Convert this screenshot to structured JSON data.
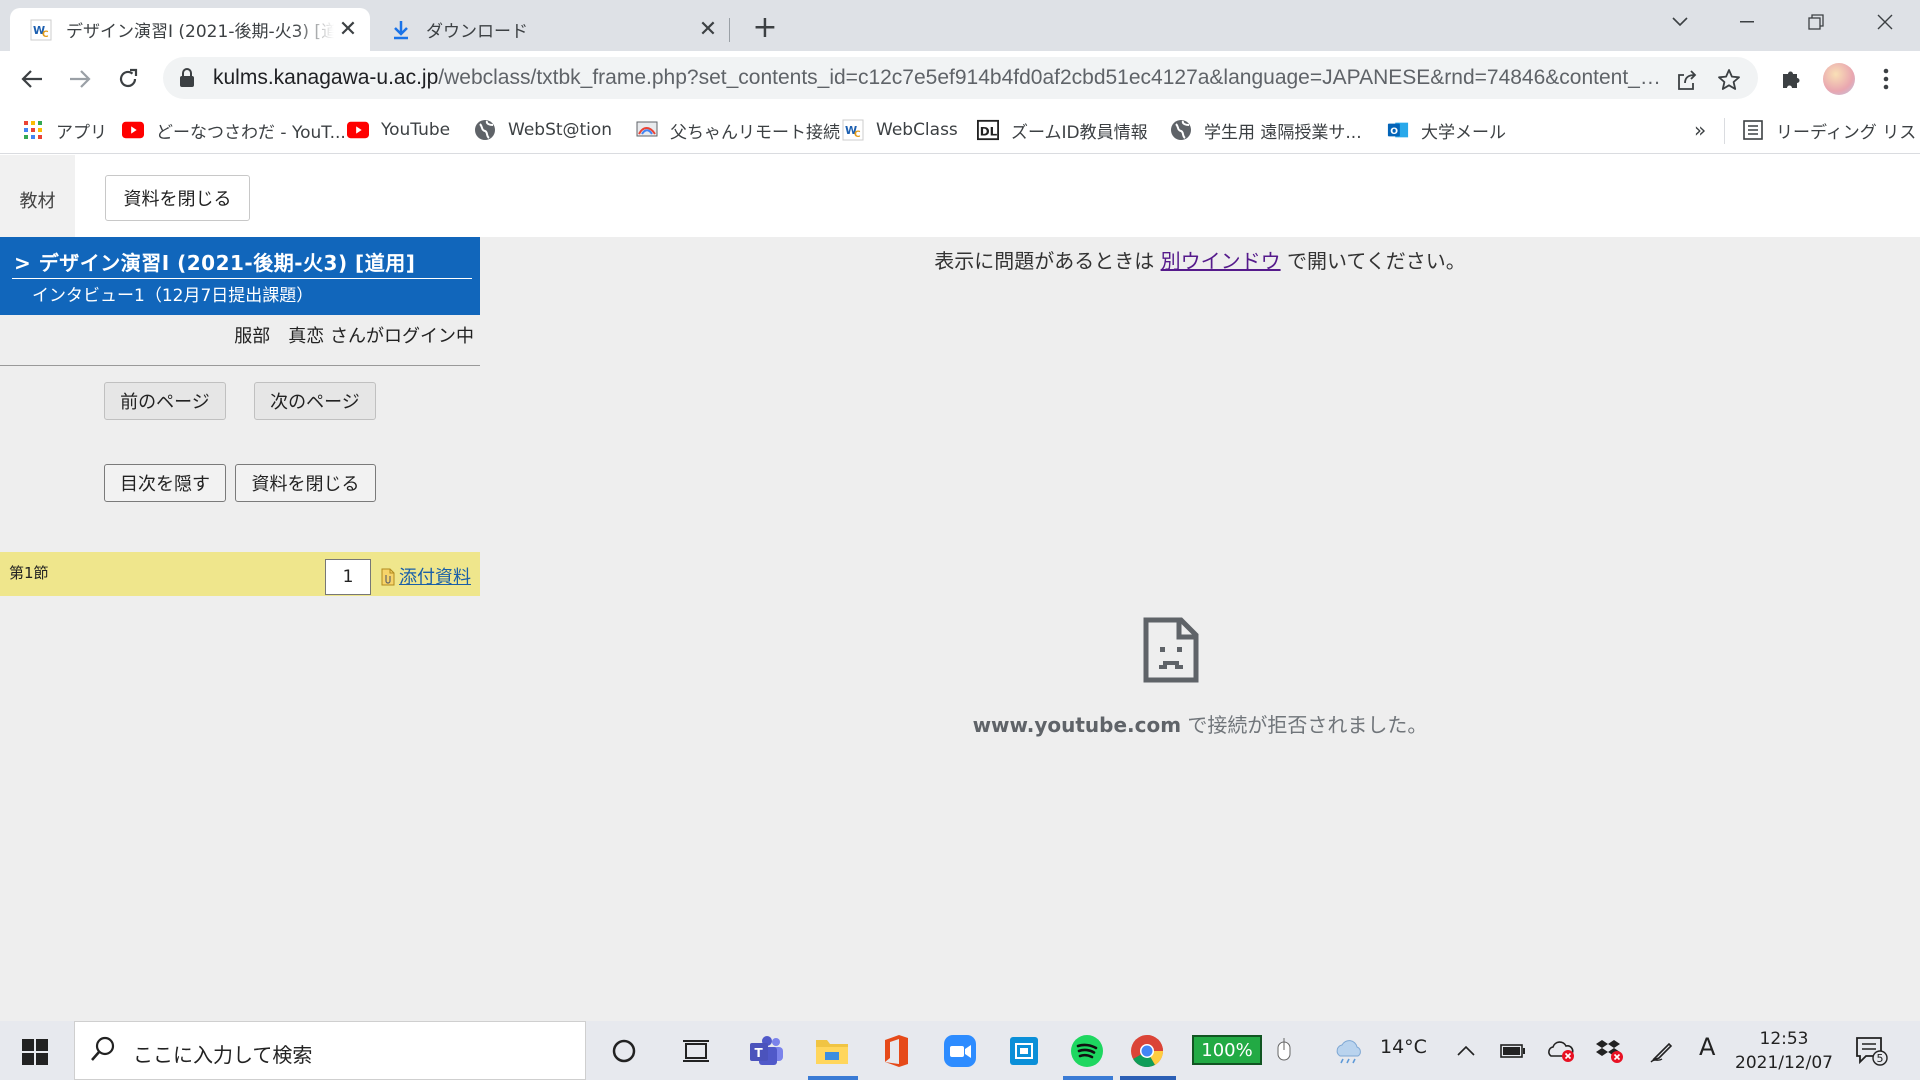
{
  "browser": {
    "tabs": [
      {
        "title": "デザイン演習I (2021-後期-火3) [道用]",
        "active": true
      },
      {
        "title": "ダウンロード",
        "active": false
      }
    ],
    "url_host": "kulms.kanagawa-u.ac.jp",
    "url_path": "/webclass/txtbk_frame.php?set_contents_id=c12c7e5ef914b4fd0af2cbd51ec4127a&language=JAPANESE&rnd=74846&content_m..."
  },
  "bookmarks": [
    {
      "label": "アプリ",
      "icon": "apps-grid-icon"
    },
    {
      "label": "どーなつさわだ - YouT...",
      "icon": "youtube-icon"
    },
    {
      "label": "YouTube",
      "icon": "youtube-icon"
    },
    {
      "label": "WebSt@tion",
      "icon": "globe-icon"
    },
    {
      "label": "父ちゃんリモート接続",
      "icon": "remote-icon"
    },
    {
      "label": "WebClass",
      "icon": "webclass-icon"
    },
    {
      "label": "ズームID教員情報",
      "icon": "dl-icon"
    },
    {
      "label": "学生用 遠隔授業サ...",
      "icon": "globe-icon"
    },
    {
      "label": "大学メール",
      "icon": "outlook-icon"
    }
  ],
  "reading_list": "リーディング リスト",
  "page": {
    "tab_label": "教材",
    "close_material": "資料を閉じる",
    "course_title": "> デザイン演習I (2021-後期-火3) [道用]",
    "course_subtitle": "インタビュー1（12月7日提出課題）",
    "login_text": "服部　真恋 さんがログイン中",
    "prev_page": "前のページ",
    "next_page": "次のページ",
    "hide_toc": "目次を隠す",
    "close_material_2": "資料を閉じる",
    "section_label": "第1節",
    "page_number": "1",
    "attachment_link": "添付資料",
    "notice_before": "表示に問題があるときは ",
    "notice_link": "別ウインドウ",
    "notice_after": " で開いてください。",
    "error_host": "www.youtube.com",
    "error_message": " で接続が拒否されました。"
  },
  "taskbar": {
    "search_placeholder": "ここに入力して検索",
    "battery": "100%",
    "temperature": "14°C",
    "ime": "A",
    "time": "12:53",
    "date": "2021/12/07",
    "notifications": "5"
  },
  "colors": {
    "course_header": "#1166bb",
    "section_row": "#efe68c",
    "content_bg": "#eeeeee",
    "visited_link": "#551a8b"
  }
}
